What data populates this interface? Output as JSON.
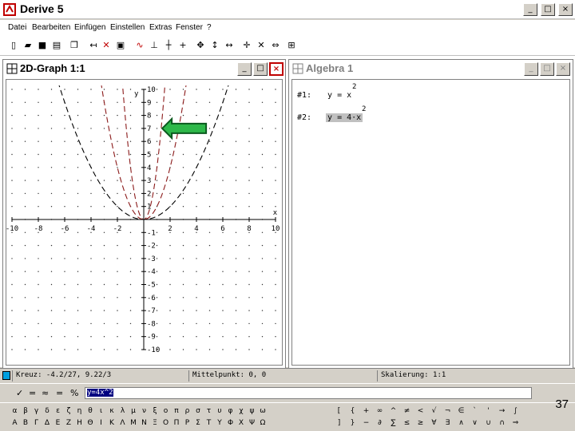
{
  "app": {
    "title": "Derive 5"
  },
  "window_controls": [
    "_",
    "□",
    "×"
  ],
  "menu": [
    "Datei",
    "Bearbeiten",
    "Einfügen",
    "Einstellen",
    "Extras",
    "Fenster",
    "?"
  ],
  "toolbar_icons": [
    "new-file-icon",
    "open-icon",
    "save-icon",
    "print-icon",
    "copy-icon",
    "arrow-icon",
    "delete-icon",
    "edit-icon",
    "plot-icon",
    "axes-icon",
    "cross-icon",
    "zoom-in-icon",
    "move-icon",
    "zoom-out-icon",
    "center-icon",
    "scale-icon",
    "trace-icon",
    "grid-icon"
  ],
  "graph_window": {
    "title": "2D-Graph 1:1",
    "controls": [
      "_",
      "□",
      "×"
    ]
  },
  "algebra_window": {
    "title": "Algebra 1",
    "controls": [
      "_",
      "□",
      "×"
    ],
    "expressions": [
      {
        "label": "#1:",
        "lhs": "y",
        "op": "=",
        "base": "x",
        "exponent": "2",
        "highlighted": false
      },
      {
        "label": "#2:",
        "lhs": "y",
        "op": "=",
        "base": "4·x",
        "exponent": "2",
        "highlighted": true
      }
    ]
  },
  "chart_data": {
    "type": "line",
    "xlabel": "x",
    "ylabel": "y",
    "xlim": [
      -10,
      10
    ],
    "ylim": [
      -10,
      10
    ],
    "x_ticks": [
      "-10",
      "-8",
      "-6",
      "-4",
      "-2",
      "2",
      "4",
      "6",
      "8",
      "10"
    ],
    "y_ticks": [
      "10",
      "9",
      "8",
      "7",
      "6",
      "5",
      "4",
      "3",
      "2",
      "1",
      "-1",
      "-2",
      "-3",
      "-4",
      "-5",
      "-6",
      "-7",
      "-8",
      "-9",
      "-10"
    ],
    "grid": true,
    "series": [
      {
        "name": "y = x^2",
        "color": "#8b1a1a",
        "values": [
          [
            -4.2,
            17.64
          ],
          [
            -3,
            9
          ],
          [
            -2,
            4
          ],
          [
            -1,
            1
          ],
          [
            0,
            0
          ],
          [
            1,
            1
          ],
          [
            2,
            4
          ],
          [
            3,
            9
          ],
          [
            4.2,
            17.64
          ]
        ]
      },
      {
        "name": "y = 4x^2",
        "color": "#8b1a1a",
        "values": [
          [
            -1.6,
            10.24
          ],
          [
            -1.5,
            9
          ],
          [
            -1,
            4
          ],
          [
            -0.5,
            1
          ],
          [
            0,
            0
          ],
          [
            0.5,
            1
          ],
          [
            1,
            4
          ],
          [
            1.5,
            9
          ],
          [
            1.6,
            10.24
          ]
        ]
      },
      {
        "name": "y = 1/4 x^2 (dashed)",
        "color": "#000000",
        "values": [
          [
            -6.5,
            10.56
          ],
          [
            -6,
            9
          ],
          [
            -4,
            4
          ],
          [
            -2,
            1
          ],
          [
            0,
            0
          ],
          [
            2,
            1
          ],
          [
            4,
            4
          ],
          [
            6,
            9
          ],
          [
            6.5,
            10.56
          ]
        ]
      }
    ],
    "annotation": "green arrow pointing at y-axis near 7"
  },
  "status": {
    "cross": "Kreuz: -4.2/27, 9.22/3",
    "center": "Mittelpunkt: 0, 0",
    "scale": "Skalierung: 1:1"
  },
  "entry": {
    "value": "y=4x^2"
  },
  "entry_icons": [
    "✓",
    "=",
    "≈",
    "=",
    "%"
  ],
  "symbols_greek": [
    "α",
    "β",
    "γ",
    "δ",
    "ε",
    "ζ",
    "η",
    "θ",
    "ι",
    "κ",
    "λ",
    "μ",
    "ν",
    "ξ",
    "ο",
    "π",
    "ρ",
    "σ",
    "τ",
    "υ",
    "φ",
    "χ",
    "ψ",
    "ω",
    "Α",
    "Β",
    "Γ",
    "Δ",
    "Ε",
    "Ζ",
    "Η",
    "Θ",
    "Ι",
    "Κ",
    "Λ",
    "Μ",
    "Ν",
    "Ξ",
    "Ο",
    "Π",
    "Ρ",
    "Σ",
    "Τ",
    "Υ",
    "Φ",
    "Χ",
    "Ψ",
    "Ω"
  ],
  "symbols_math": [
    "[",
    "{",
    "+",
    "∞",
    "^",
    "≠",
    "<",
    "√",
    "¬",
    "∈",
    "`",
    "'",
    "→",
    "∫",
    "]",
    "}",
    "−",
    "∂",
    "∑",
    "≤",
    "≥",
    "∀",
    "∃",
    "∧",
    "∨",
    "∪",
    "∩",
    "⇒"
  ],
  "page_number": "37"
}
